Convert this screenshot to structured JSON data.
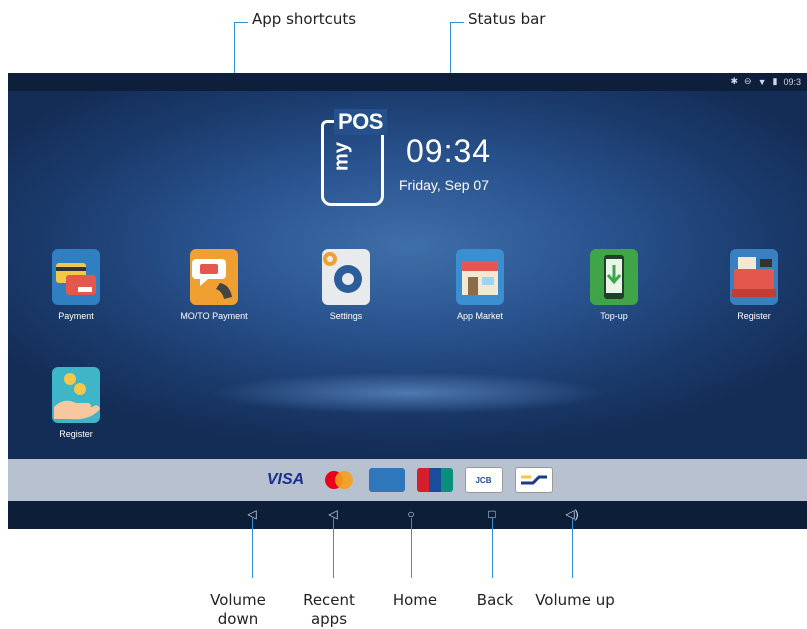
{
  "callouts": {
    "app_shortcuts": "App shortcuts",
    "status_bar": "Status bar",
    "volume_down": "Volume down",
    "recent_apps": "Recent apps",
    "home": "Home",
    "back": "Back",
    "volume_up": "Volume up"
  },
  "status_bar": {
    "icons": [
      "bluetooth-icon",
      "do-not-disturb-icon",
      "wifi-icon",
      "battery-icon"
    ],
    "time": "09:3"
  },
  "home_screen": {
    "logo_text": "POS",
    "logo_prefix": "my",
    "clock": "09:34",
    "date": "Friday, Sep 07"
  },
  "apps": [
    {
      "label": "Payment",
      "icon": "payment-card-icon",
      "color": "#2f7fc1"
    },
    {
      "label": "MO/TO Payment",
      "icon": "phone-order-icon",
      "color": "#f0a030"
    },
    {
      "label": "Settings",
      "icon": "gear-icon",
      "color": "#e8eaee"
    },
    {
      "label": "App Market",
      "icon": "market-store-icon",
      "color": "#3b8fd0"
    },
    {
      "label": "Top-up",
      "icon": "phone-topup-icon",
      "color": "#3fa548"
    },
    {
      "label": "Register",
      "icon": "cash-register-icon",
      "color": "#3a7fc0"
    },
    {
      "label": "Register",
      "icon": "coin-hand-icon",
      "color": "#3fb6c8"
    }
  ],
  "card_brands": [
    "VISA",
    "mastercard",
    "AMEX",
    "UnionPay",
    "JCB",
    "Bancontact"
  ],
  "nav_buttons": [
    "volume-down-icon",
    "recent-apps-icon",
    "home-icon",
    "back-icon",
    "volume-up-icon"
  ]
}
